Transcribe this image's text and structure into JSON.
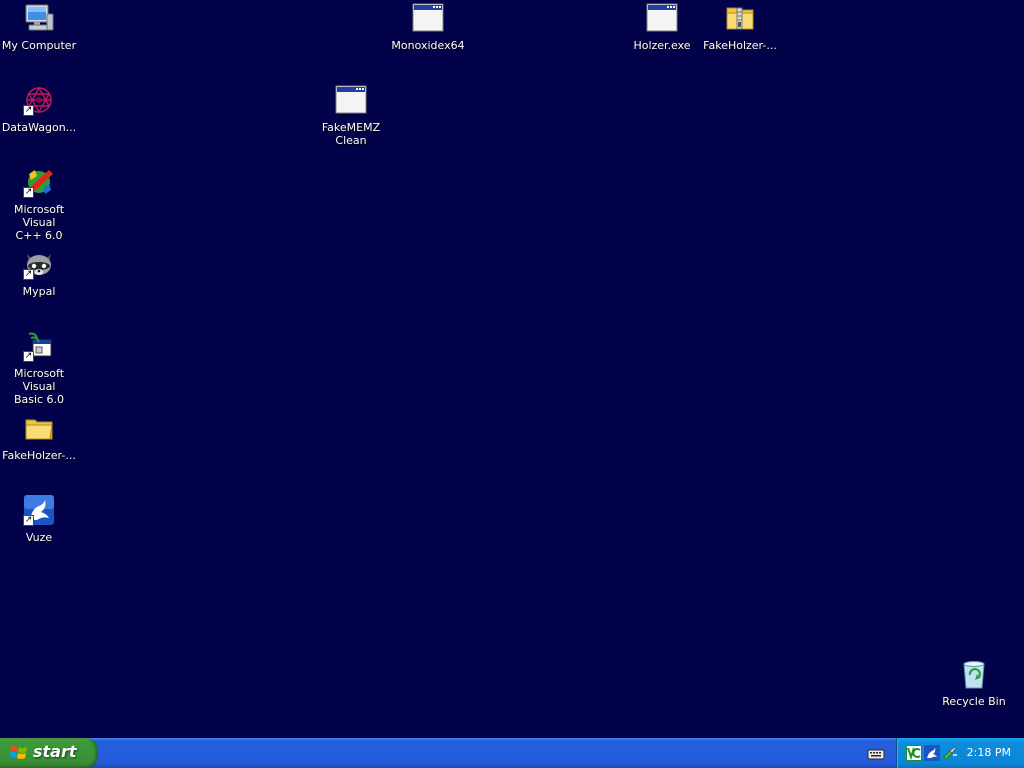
{
  "desktop": {
    "background": "#02024a",
    "icons": [
      {
        "label": "My Computer",
        "icon": "my-computer-icon"
      },
      {
        "label": "DataWagon...",
        "icon": "datawagon-icon",
        "shortcut": true
      },
      {
        "label": "Microsoft Visual\nC++ 6.0",
        "icon": "visual-cpp-icon",
        "shortcut": true
      },
      {
        "label": "Mypal",
        "icon": "mypal-icon",
        "shortcut": true
      },
      {
        "label": "Microsoft Visual\nBasic 6.0",
        "icon": "visual-basic-icon",
        "shortcut": true
      },
      {
        "label": "FakeHolzer-...",
        "icon": "folder-icon"
      },
      {
        "label": "Vuze",
        "icon": "vuze-icon",
        "shortcut": true
      },
      {
        "label": "FakeMEMZ\nClean",
        "icon": "application-window-icon"
      },
      {
        "label": "Monoxidex64",
        "icon": "application-window-icon"
      },
      {
        "label": "Holzer.exe",
        "icon": "application-window-icon"
      },
      {
        "label": "FakeHolzer-...",
        "icon": "zip-folder-icon"
      },
      {
        "label": "Recycle Bin",
        "icon": "recycle-bin-icon"
      }
    ]
  },
  "taskbar": {
    "start_label": "start",
    "clock": "2:18 PM",
    "colors": {
      "start": "#3c9a3a",
      "bar": "#245edb",
      "tray": "#0f8ddd"
    }
  }
}
